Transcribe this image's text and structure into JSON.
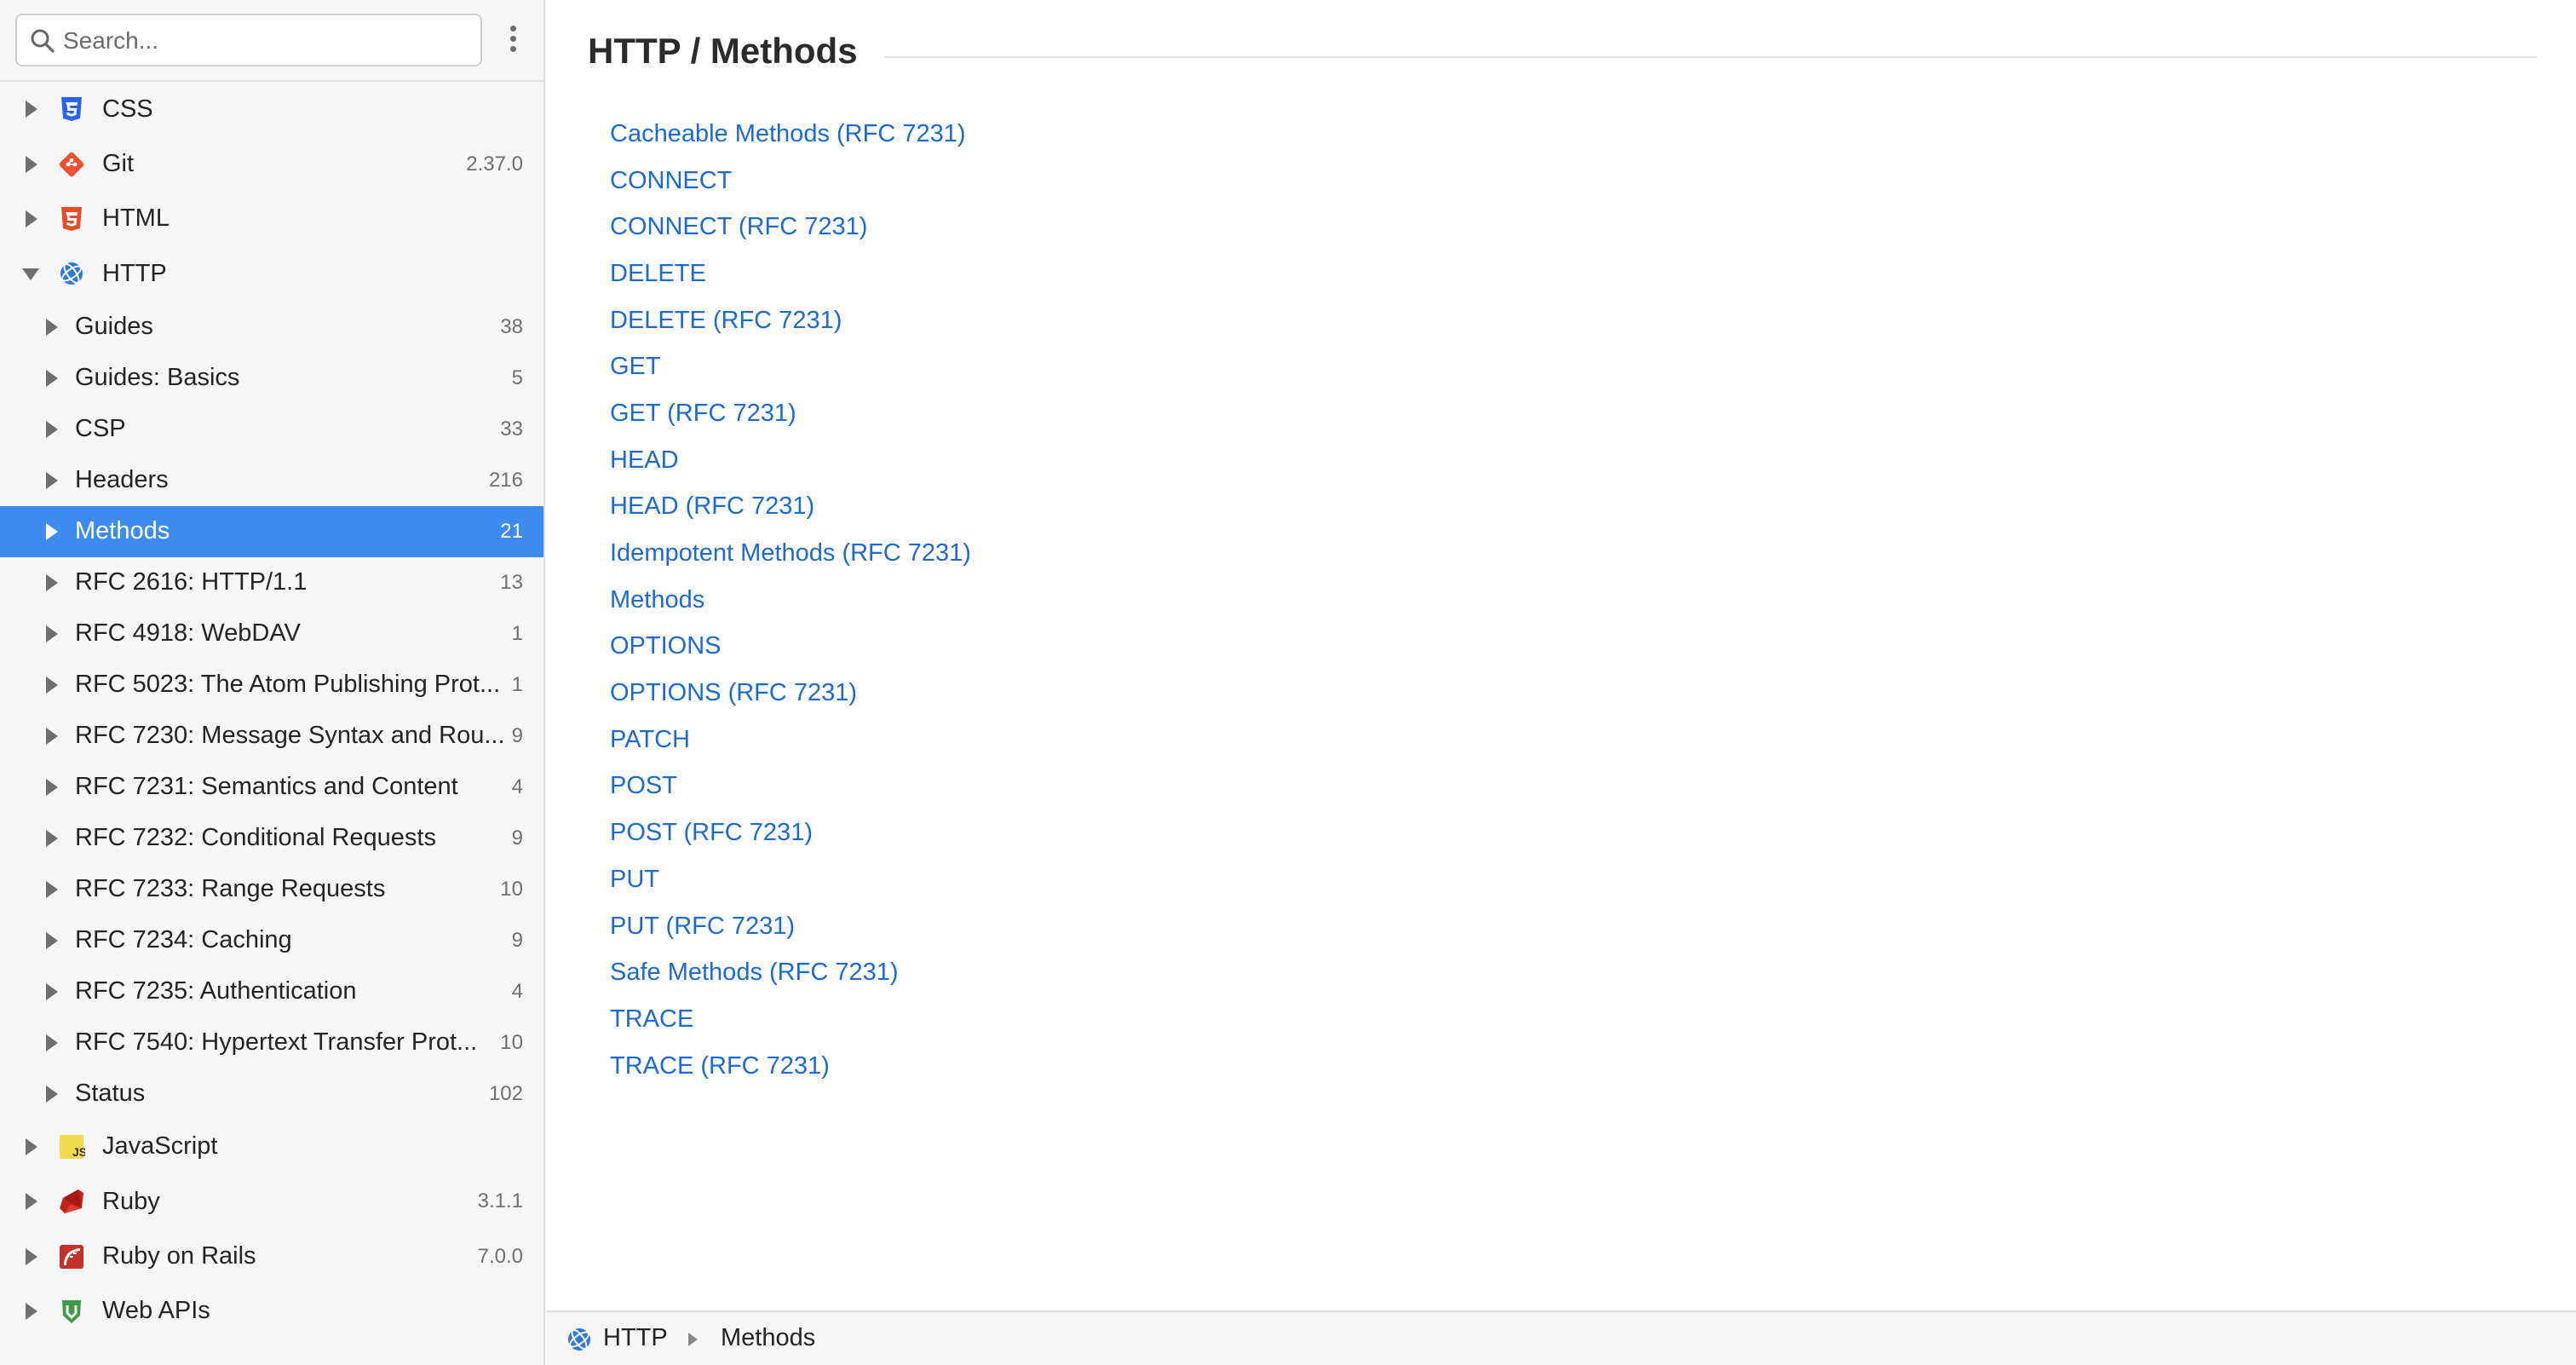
{
  "search": {
    "placeholder": "Search..."
  },
  "colors": {
    "accent": "#3d8af0",
    "link": "#1d6ad2",
    "sidebar_bg": "#f6f6f6"
  },
  "sidebar": {
    "top_before": [
      {
        "label": "CSS",
        "count": "",
        "icon": "css-icon"
      },
      {
        "label": "Git",
        "count": "2.37.0",
        "icon": "git-icon"
      },
      {
        "label": "HTML",
        "count": "",
        "icon": "html-icon"
      }
    ],
    "expanded": {
      "label": "HTTP",
      "count": "",
      "icon": "http-globe-icon"
    },
    "children": [
      {
        "label": "Guides",
        "count": "38"
      },
      {
        "label": "Guides: Basics",
        "count": "5"
      },
      {
        "label": "CSP",
        "count": "33"
      },
      {
        "label": "Headers",
        "count": "216"
      },
      {
        "label": "Methods",
        "count": "21"
      },
      {
        "label": "RFC 2616: HTTP/1.1",
        "count": "13"
      },
      {
        "label": "RFC 4918: WebDAV",
        "count": "1"
      },
      {
        "label": "RFC 5023: The Atom Publishing Prot...",
        "count": "1"
      },
      {
        "label": "RFC 7230: Message Syntax and Rou...",
        "count": "9"
      },
      {
        "label": "RFC 7231: Semantics and Content",
        "count": "4"
      },
      {
        "label": "RFC 7232: Conditional Requests",
        "count": "9"
      },
      {
        "label": "RFC 7233: Range Requests",
        "count": "10"
      },
      {
        "label": "RFC 7234: Caching",
        "count": "9"
      },
      {
        "label": "RFC 7235: Authentication",
        "count": "4"
      },
      {
        "label": "RFC 7540: Hypertext Transfer Prot...",
        "count": "10"
      },
      {
        "label": "Status",
        "count": "102"
      }
    ],
    "top_after": [
      {
        "label": "JavaScript",
        "count": "",
        "icon": "javascript-icon"
      },
      {
        "label": "Ruby",
        "count": "3.1.1",
        "icon": "ruby-icon"
      },
      {
        "label": "Ruby on Rails",
        "count": "7.0.0",
        "icon": "rails-icon"
      },
      {
        "label": "Web APIs",
        "count": "",
        "icon": "webapis-shield-icon"
      }
    ]
  },
  "main": {
    "title": "HTTP / Methods",
    "entries": [
      "Cacheable Methods (RFC 7231)",
      "CONNECT",
      "CONNECT (RFC 7231)",
      "DELETE",
      "DELETE (RFC 7231)",
      "GET",
      "GET (RFC 7231)",
      "HEAD",
      "HEAD (RFC 7231)",
      "Idempotent Methods (RFC 7231)",
      "Methods",
      "OPTIONS",
      "OPTIONS (RFC 7231)",
      "PATCH",
      "POST",
      "POST (RFC 7231)",
      "PUT",
      "PUT (RFC 7231)",
      "Safe Methods (RFC 7231)",
      "TRACE",
      "TRACE (RFC 7231)"
    ]
  },
  "pathbar": {
    "crumbs": [
      "HTTP",
      "Methods"
    ]
  }
}
